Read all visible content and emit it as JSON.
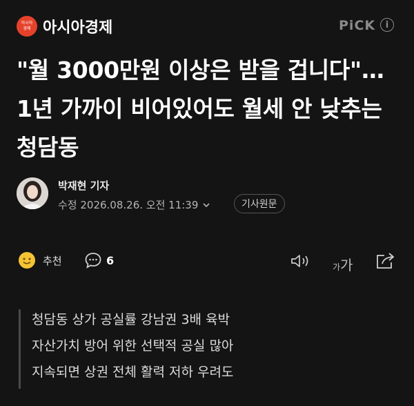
{
  "header": {
    "logo_text": "아시아경제",
    "press_name": "아시아경제",
    "pick_label": "PiCK",
    "info_symbol": "i"
  },
  "article": {
    "headline": "\"월 3000만원 이상은 받을 겁니다\"…1년 가까이 비어있어도 월세 안 낮추는 청담동",
    "reporter": "박재현 기자",
    "date": "수정 2026.08.26. 오전 11:39",
    "original_button": "기사원문"
  },
  "actions": {
    "recommend_label": "추천",
    "comment_count": "6",
    "font_small": "가",
    "font_big": "가"
  },
  "summary": [
    "청담동 상가 공실률 강남권 3배 육박",
    "자산가치 방어 위한 선택적 공실 많아",
    "지속되면 상권 전체 활력 저하 우려도"
  ],
  "colors": {
    "background": "#141414",
    "brand": "#e5422b"
  }
}
